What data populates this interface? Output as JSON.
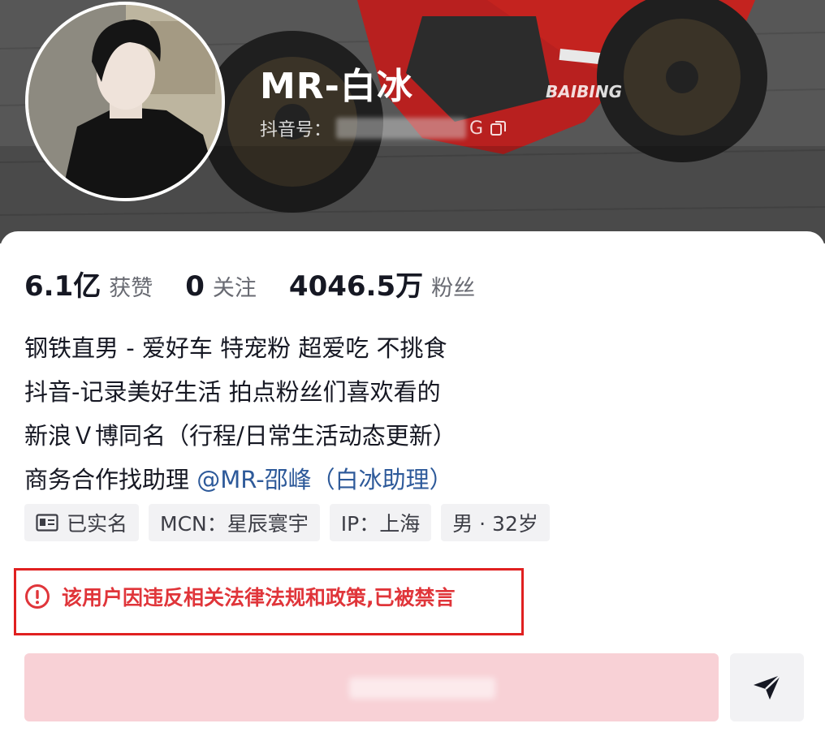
{
  "profile": {
    "nickname": "MR-白冰",
    "douyin_id_label": "抖音号：",
    "douyin_id_tail": "G"
  },
  "stats": [
    {
      "value": "6.1亿",
      "label": "获赞"
    },
    {
      "value": "0",
      "label": "关注"
    },
    {
      "value": "4046.5万",
      "label": "粉丝"
    }
  ],
  "bio": {
    "line1": "钢铁直男 - 爱好车 特宠粉 超爱吃 不挑食",
    "line2": "抖音-记录美好生活 拍点粉丝们喜欢看的",
    "line3": "新浪Ｖ博同名（行程/日常生活动态更新）",
    "line4_prefix": "商务合作找助理 ",
    "line4_mention": "@MR-邵峰（白冰助理）"
  },
  "tags": {
    "verified": "已实名",
    "mcn": "MCN：星辰寰宇",
    "ip": "IP：上海",
    "gender_age": "男 · 32岁"
  },
  "warning": {
    "text": "该用户因违反相关法律法规和政策,已被禁言"
  },
  "icons": {
    "copy": "copy-icon",
    "id_card": "id-card-icon",
    "warning": "exclamation-circle-icon",
    "share": "send-arrow-icon"
  },
  "colors": {
    "accent_warning": "#e0353a",
    "follow_button_bg": "#f8d1d6",
    "mention": "#2e5a9a"
  }
}
